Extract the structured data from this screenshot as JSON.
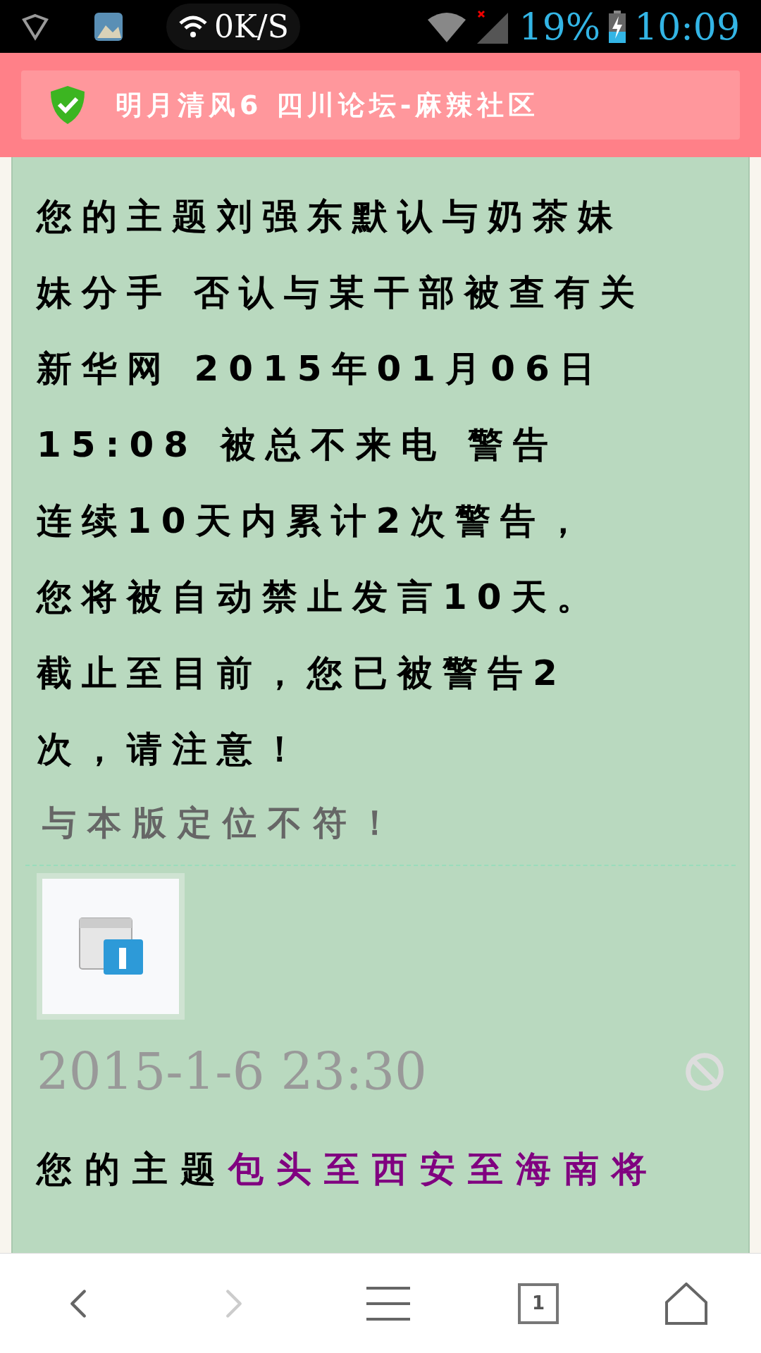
{
  "status_bar": {
    "speed": "0K/S",
    "battery": "19%",
    "time": "10:09"
  },
  "header": {
    "title": "明月清风6 四川论坛-麻辣社区"
  },
  "posts": [
    {
      "kind": "warning",
      "lines": [
        "您的主题刘强东默认与奶茶妹",
        "妹分手 否认与某干部被查有关",
        "新华网 2015年01月06日",
        "15:08 被总不来电 警告",
        "连续10天内累计2次警告，",
        "您将被自动禁止发言10天。",
        "截止至目前，您已被警告2",
        "次，请注意！"
      ],
      "reason": "与本版定位不符！",
      "date": "2015-1-6 23:30"
    },
    {
      "kind": "topic",
      "prefix": "您的主题",
      "link": "包头至西安至海南将"
    }
  ],
  "nav": {
    "tabs_count": "1"
  }
}
